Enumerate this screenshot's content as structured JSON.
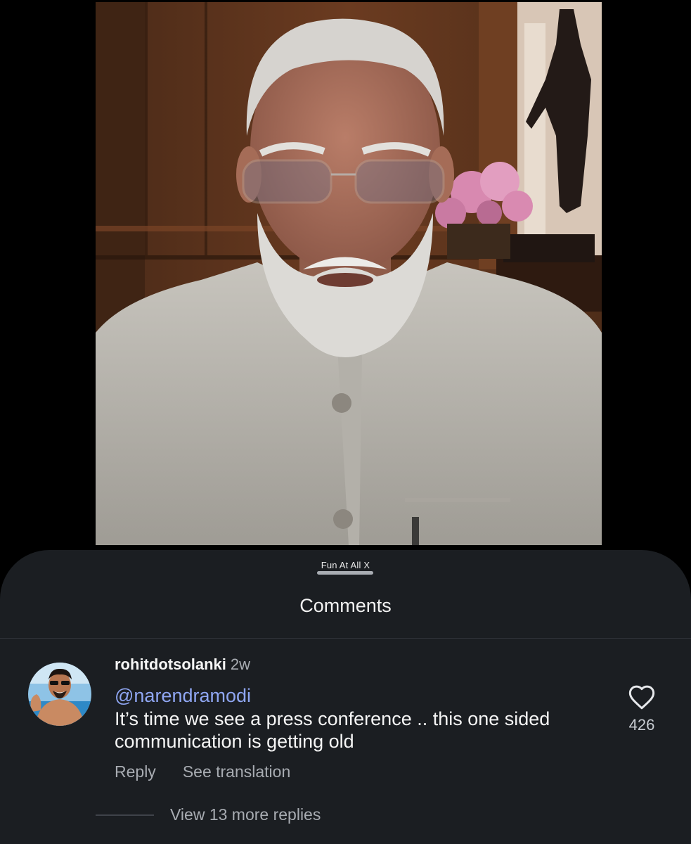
{
  "sheet": {
    "watermark": "Fun At All X",
    "title": "Comments"
  },
  "comment": {
    "username": "rohitdotsolanki",
    "timestamp": "2w",
    "mention": "@narendramodi",
    "text": "It’s time we see a press conference .. this one sided communication is getting old",
    "like_count": "426",
    "reply_label": "Reply",
    "translate_label": "See translation",
    "view_replies_label": "View 13 more replies"
  },
  "icons": {
    "like": "heart-outline-icon"
  },
  "colors": {
    "background": "#000000",
    "sheet": "#1b1e22",
    "mention": "#8fa6f2",
    "secondary_text": "#a8acb2"
  }
}
